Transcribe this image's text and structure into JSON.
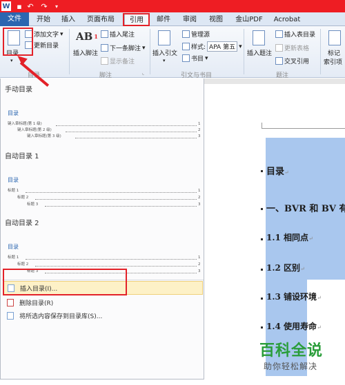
{
  "quick_access": {
    "word_icon": "W",
    "undo": "↶",
    "redo": "↷"
  },
  "tabs": [
    "文件",
    "开始",
    "插入",
    "页面布局",
    "引用",
    "邮件",
    "审阅",
    "视图",
    "金山PDF",
    "Acrobat"
  ],
  "ribbon": {
    "toc_button": "目录",
    "add_text": "添加文字",
    "update_toc": "更新目录",
    "insert_footnote": "插入脚注",
    "insert_endnote": "插入尾注",
    "next_footnote": "下一条脚注",
    "show_notes": "显示备注",
    "insert_citation": "插入引文",
    "manage_sources": "管理源",
    "style_label": "样式:",
    "style_value": "APA 第五",
    "bibliography": "书目",
    "insert_caption": "插入题注",
    "insert_table_of_figures": "插入表目录",
    "update_table": "更新表格",
    "cross_reference": "交叉引用",
    "mark_entry": "标记",
    "mark_entry_line2": "索引项",
    "groups": {
      "toc": "目录",
      "footnotes": "脚注",
      "citations": "引文与书目",
      "captions": "题注"
    }
  },
  "dropdown": {
    "manual_title": "手动目录",
    "auto1_title": "自动目录 1",
    "auto2_title": "自动目录 2",
    "toc_heading": "目录",
    "manual_lines": [
      "键入章标题(第 1 级)",
      "键入章标题(第 2 级)",
      "键入章标题(第 3 级)"
    ],
    "auto_lines": [
      "标题 1",
      "标题 2",
      "标题 3"
    ],
    "nums": [
      "1",
      "2",
      "3"
    ],
    "insert_toc": "插入目录(I)...",
    "remove_toc": "删除目录(R)",
    "save_selection": "将所选内容保存到目录库(S)..."
  },
  "document": {
    "lines": [
      "目录",
      "一、BVR 和 BV 有",
      "1.1 相同点",
      "1.2 区别",
      "1.3 铺设环境",
      "1.4 使用寿命"
    ],
    "para_mark": "↵"
  },
  "watermark": {
    "title": "百科全说",
    "subtitle": "助你轻松解决"
  },
  "colors": {
    "accent_red": "#e32128",
    "file_blue": "#2b66b0",
    "selection": "#a9c7ee",
    "watermark_green": "#2a9d3a"
  }
}
